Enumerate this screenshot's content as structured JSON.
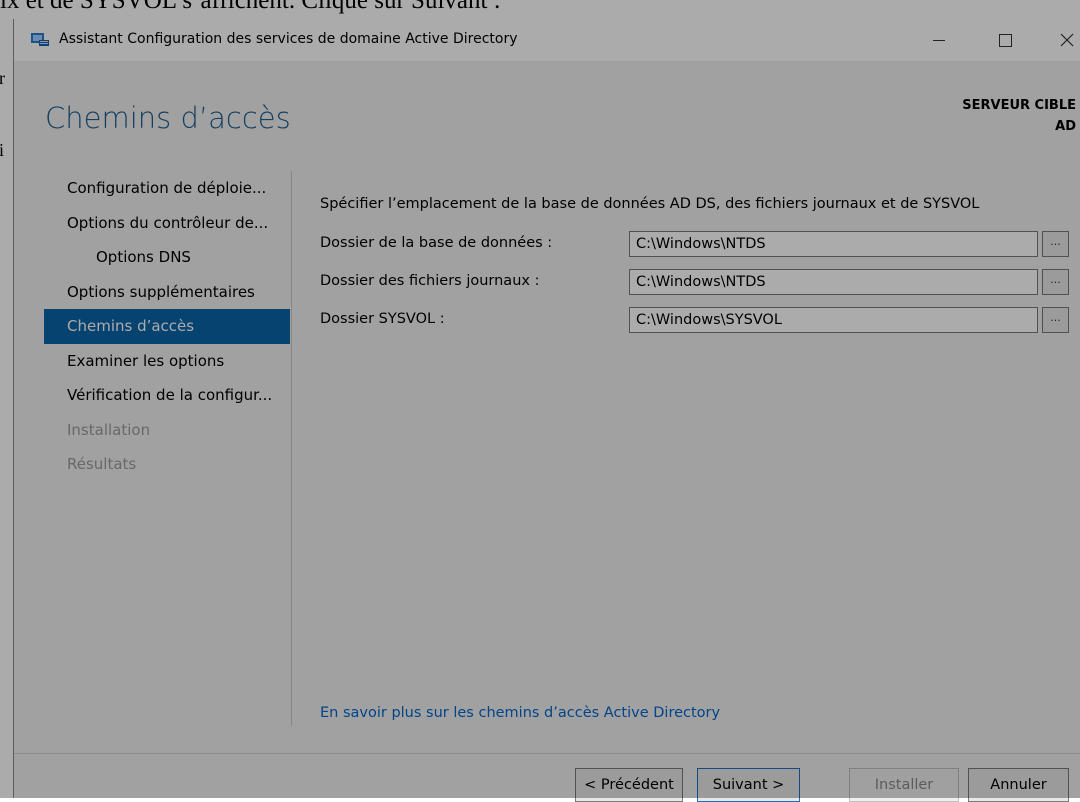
{
  "document": {
    "top_line": "ix et de SYSVOL s’affichent. Clique sur Suivant :",
    "edge_fragments": [
      "r",
      "i"
    ]
  },
  "window": {
    "title": "Assistant Configuration des services de domaine Active Directory",
    "controls": {
      "minimize": "—",
      "close": "✕"
    }
  },
  "page": {
    "title": "Chemins d’accès",
    "target_label": "SERVEUR CIBLE",
    "target_name": "AD"
  },
  "nav": [
    {
      "label": "Configuration de déploie...",
      "state": "normal"
    },
    {
      "label": "Options du contrôleur de...",
      "state": "normal"
    },
    {
      "label": "Options DNS",
      "state": "normal"
    },
    {
      "label": "Options supplémentaires",
      "state": "normal"
    },
    {
      "label": "Chemins d’accès",
      "state": "active"
    },
    {
      "label": "Examiner les options",
      "state": "normal"
    },
    {
      "label": "Vérification de la configur...",
      "state": "normal"
    },
    {
      "label": "Installation",
      "state": "disabled"
    },
    {
      "label": "Résultats",
      "state": "disabled"
    }
  ],
  "content": {
    "description": "Spécifier l’emplacement de la base de données AD DS, des fichiers journaux et de SYSVOL",
    "fields": [
      {
        "label": "Dossier de la base de données :",
        "value": "C:\\Windows\\NTDS",
        "browse": "..."
      },
      {
        "label": "Dossier des fichiers journaux :",
        "value": "C:\\Windows\\NTDS",
        "browse": "..."
      },
      {
        "label": "Dossier SYSVOL :",
        "value": "C:\\Windows\\SYSVOL",
        "browse": "..."
      }
    ],
    "help_link": "En savoir plus sur les chemins d’accès Active Directory"
  },
  "buttons": {
    "previous": "< Précédent",
    "next": "Suivant >",
    "install": "Installer",
    "cancel": "Annuler"
  },
  "colors": {
    "accent": "#0a64a8",
    "title_blue": "#1e5e8f",
    "link": "#0066cc",
    "disabled_text": "#9b9b9b"
  }
}
